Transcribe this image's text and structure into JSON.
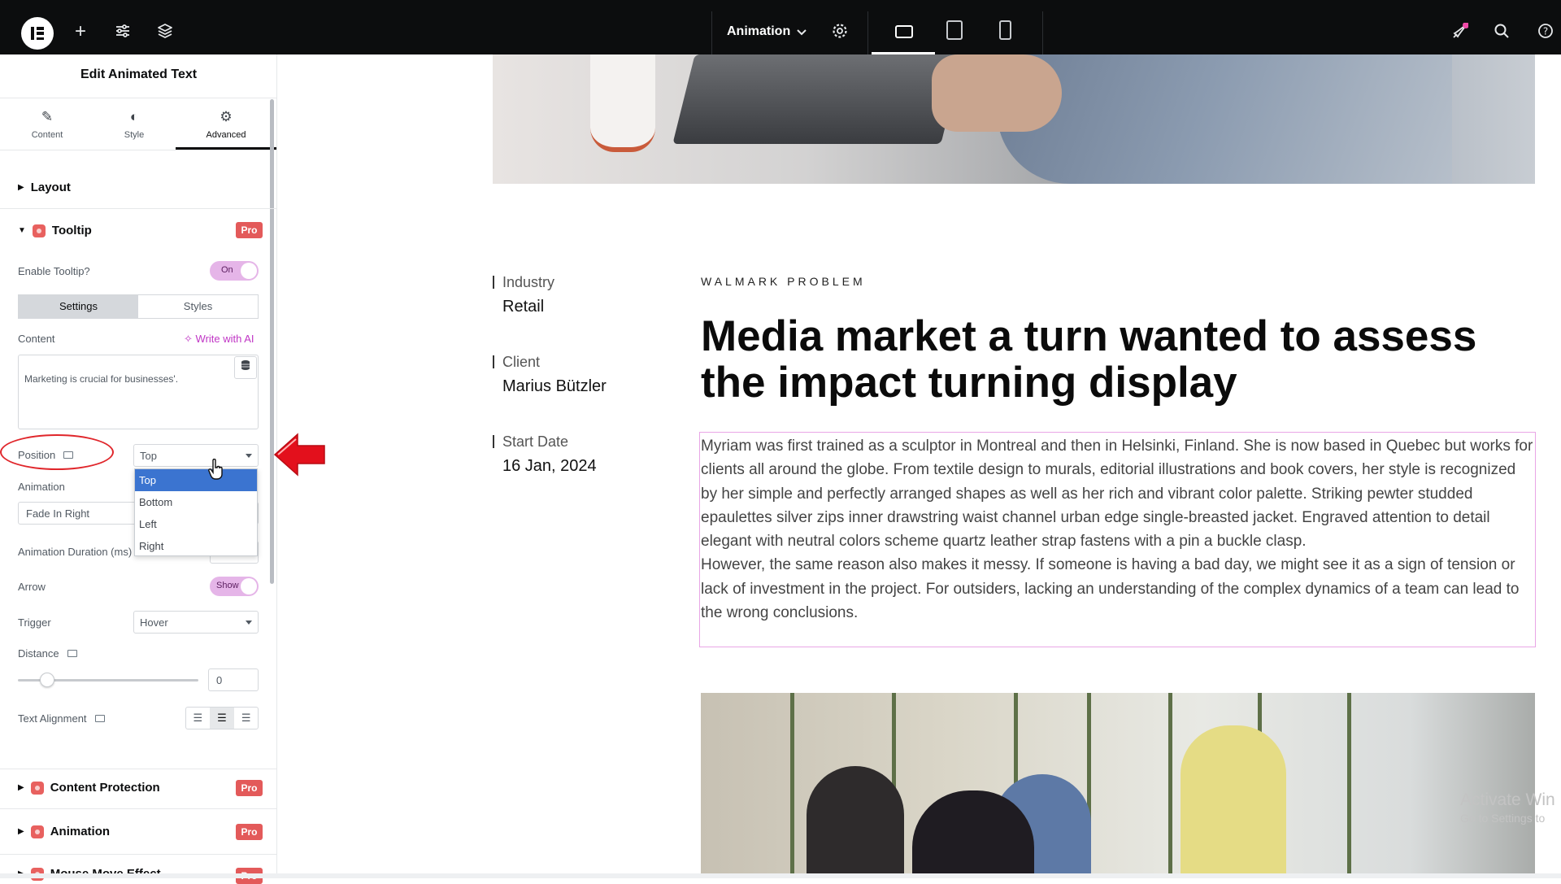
{
  "topbar": {
    "doc_title": "Animation",
    "icons": [
      "elementor-logo",
      "plus-icon",
      "sliders-icon",
      "layers-icon",
      "chevron-down-icon",
      "gear-icon",
      "desktop-icon",
      "tablet-icon",
      "mobile-icon",
      "rocket-icon",
      "search-icon",
      "help-icon"
    ]
  },
  "panel": {
    "title": "Edit Animated Text",
    "tabs": [
      {
        "label": "Content",
        "icon": "pencil-icon"
      },
      {
        "label": "Style",
        "icon": "contrast-icon"
      },
      {
        "label": "Advanced",
        "icon": "gear-icon"
      }
    ],
    "active_tab": "Advanced",
    "sections": {
      "layout": "Layout",
      "tooltip": "Tooltip",
      "content_protection": "Content Protection",
      "animation": "Animation",
      "next_partial": "Mouse Move Effect"
    },
    "pro_label": "Pro",
    "tooltip": {
      "enable_label": "Enable Tooltip?",
      "enable_state": "On",
      "settings_tab": "Settings",
      "styles_tab": "Styles",
      "content_label": "Content",
      "write_ai": "Write with AI",
      "content_value": "Marketing is crucial for businesses'.",
      "position_label": "Position",
      "position_value": "Top",
      "position_options": [
        "Top",
        "Bottom",
        "Left",
        "Right"
      ],
      "animation_label": "Animation",
      "animation_value": "Fade In Right",
      "duration_label": "Animation Duration (ms)",
      "arrow_label": "Arrow",
      "arrow_state": "Show",
      "trigger_label": "Trigger",
      "trigger_value": "Hover",
      "distance_label": "Distance",
      "distance_value": "0",
      "distance_slider_fraction": 0.12,
      "text_alignment_label": "Text Alignment",
      "alignment_options": [
        "left",
        "center",
        "right"
      ],
      "alignment_selected": "center"
    }
  },
  "page": {
    "meta": [
      {
        "label": "Industry",
        "value": "Retail"
      },
      {
        "label": "Client",
        "value": "Marius Bützler"
      },
      {
        "label": "Start Date",
        "value": "16 Jan, 2024"
      }
    ],
    "eyebrow": "WALMARK PROBLEM",
    "headline": "Media market a turn wanted to assess the impact turning display",
    "body_p1": "Myriam was first trained as a sculptor in Montreal and then in Helsinki, Finland. She is now based in Quebec but works for clients all around the globe. From textile design to murals, editorial illustrations and book covers, her style is recognized by her simple and perfectly arranged shapes as well as her rich and vibrant color palette. Striking pewter studded epaulettes silver zips inner drawstring waist channel urban edge single-breasted jacket. Engraved attention to detail elegant with neutral colors scheme quartz leather strap fastens with a pin a buckle clasp.",
    "body_p2": "However, the same reason also makes it messy. If someone is having a bad day, we might see it as a sign of tension or lack of investment in the project. For outsiders, lacking an understanding of the complex dynamics of a team can lead to the wrong conclusions."
  },
  "watermark": {
    "line1": "Activate Win",
    "line2": "Go to Settings to"
  },
  "colors": {
    "topbar_bg": "#0c0d0e",
    "accent_pink": "#c036c5",
    "pro_red": "#e35a5a",
    "dropdown_selected": "#3b74d0",
    "annotation_red": "#e0262b"
  }
}
